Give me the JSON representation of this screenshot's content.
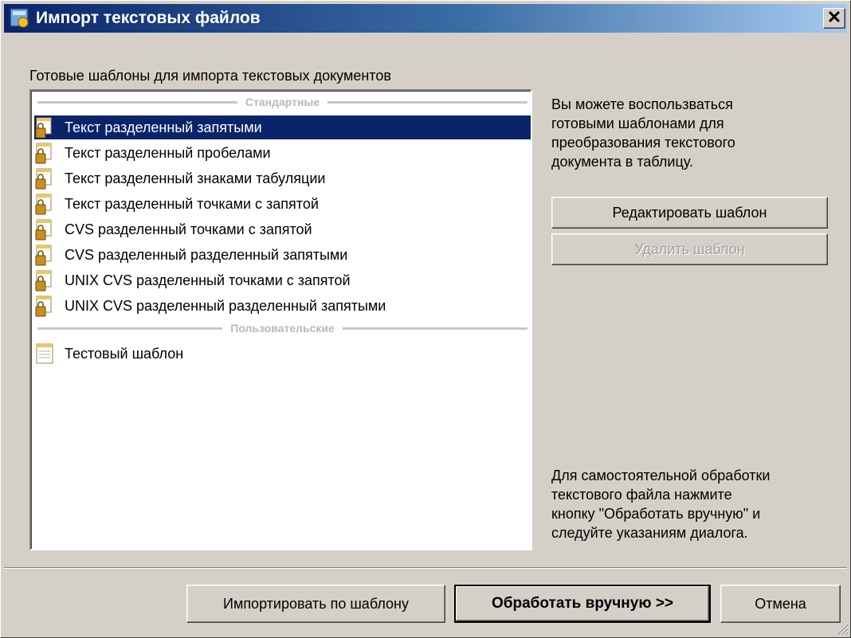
{
  "window": {
    "title": "Импорт текстовых файлов",
    "close_label": "✕"
  },
  "templates_label": "Готовые шаблоны для импорта текстовых документов",
  "groups": {
    "standard": "Стандартные",
    "user": "Пользовательские"
  },
  "standard_items": [
    {
      "label": "Текст разделенный запятыми",
      "selected": true
    },
    {
      "label": "Текст разделенный пробелами"
    },
    {
      "label": "Текст разделенный знаками табуляции"
    },
    {
      "label": "Текст разделенный точками с запятой"
    },
    {
      "label": "CVS разделенный точками с запятой"
    },
    {
      "label": "CVS разделенный разделенный запятыми"
    },
    {
      "label": "UNIX CVS разделенный точками с запятой"
    },
    {
      "label": "UNIX CVS разделенный разделенный запятыми"
    }
  ],
  "user_items": [
    {
      "label": "Тестовый шаблон"
    }
  ],
  "hint_top": [
    "Вы можете воспользваться",
    "готовыми шаблонами для",
    "преобразования текстового",
    "документа в таблицу."
  ],
  "hint_bottom": [
    "Для самостоятельной обработки",
    "текстового файла нажмите",
    "кнопку \"Обработать вручную\" и",
    "следуйте указаниям диалога."
  ],
  "buttons": {
    "edit_template": "Редактировать шаблон",
    "delete_template": "Удалить шаблон",
    "import_by_template": "Импортировать по шаблону",
    "process_manually": "Обработать вручную >>",
    "cancel": "Отмена"
  },
  "colors": {
    "selection": "#0a246a",
    "dialog": "#d4d0c8",
    "titlebar_start": "#0a246a",
    "titlebar_end": "#a6caf0"
  }
}
